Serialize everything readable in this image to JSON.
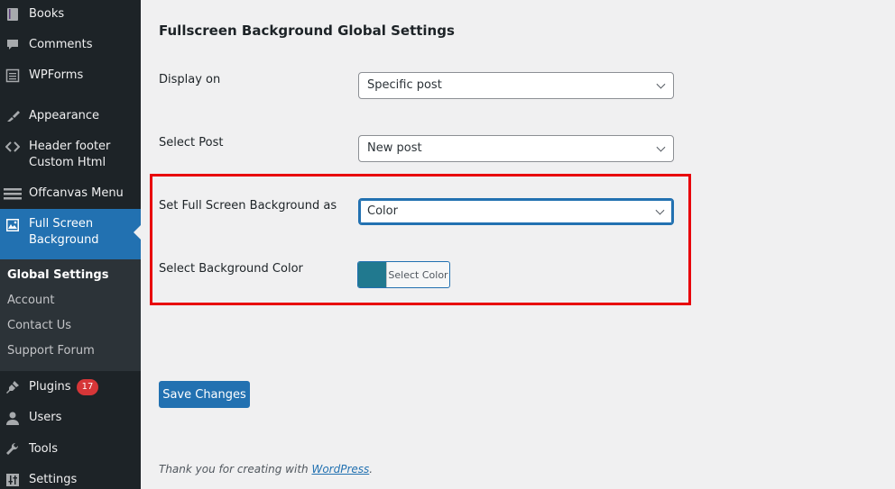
{
  "sidebar": {
    "items": [
      {
        "label": "Books",
        "icon": "book-icon"
      },
      {
        "label": "Comments",
        "icon": "comment-icon"
      },
      {
        "label": "WPForms",
        "icon": "form-icon"
      },
      {
        "label": "Appearance",
        "icon": "paintbrush-icon"
      },
      {
        "label": "Header footer",
        "label2": "Custom Html",
        "icon": "code-icon"
      },
      {
        "label": "Offcanvas Menu",
        "icon": "hamburger-icon"
      },
      {
        "label": "Full Screen",
        "label2": "Background",
        "icon": "image-icon"
      },
      {
        "label": "Plugins",
        "icon": "plugin-icon",
        "badge": "17"
      },
      {
        "label": "Users",
        "icon": "user-icon"
      },
      {
        "label": "Tools",
        "icon": "wrench-icon"
      },
      {
        "label": "Settings",
        "icon": "settings-icon"
      }
    ],
    "submenu": [
      {
        "label": "Global Settings",
        "active": true
      },
      {
        "label": "Account"
      },
      {
        "label": "Contact Us"
      },
      {
        "label": "Support Forum"
      }
    ]
  },
  "main": {
    "title": "Fullscreen Background Global Settings",
    "fields": {
      "display_on": {
        "label": "Display on",
        "value": "Specific post"
      },
      "select_post": {
        "label": "Select Post",
        "value": "New post"
      },
      "background_as": {
        "label": "Set Full Screen Background as",
        "value": "Color"
      },
      "background_color": {
        "label": "Select Background Color",
        "button_label": "Select Color",
        "color": "#21798f"
      }
    },
    "save_label": "Save Changes",
    "footer": {
      "text": "Thank you for creating with ",
      "link": "WordPress",
      "suffix": "."
    }
  },
  "colors": {
    "accent": "#2271b1",
    "highlight": "#e8000b",
    "badge": "#d63638"
  }
}
